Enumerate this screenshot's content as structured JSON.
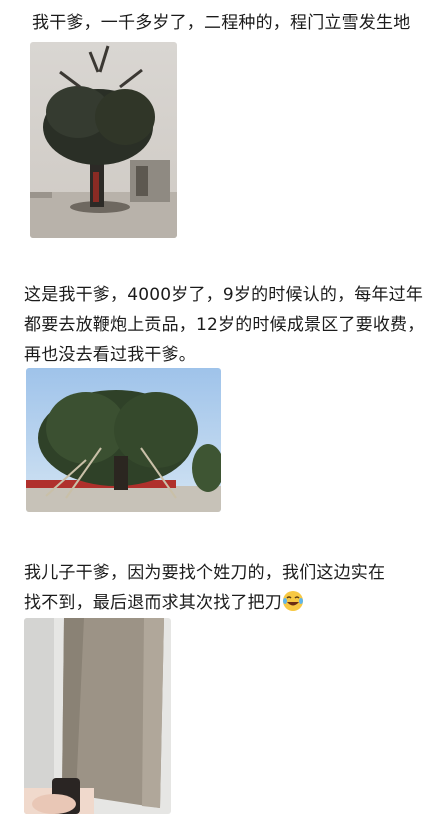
{
  "posts": [
    {
      "text": "我干爹，一千多岁了，二程种的，程门立雪发生地",
      "image": "old-cypress-tree-photo"
    },
    {
      "text": "这是我干爹，4000岁了，9岁的时候认的，每年过年都要去放鞭炮上贡品，12岁的时候成景区了要收费，再也没去看过我干爹。",
      "image": "ancient-tree-scenic-area-photo"
    },
    {
      "text": "我儿子干爹，因为要找个姓刀的，我们这边实在找不到，最后退而求其次找了把刀",
      "emoji": "laughing-tears-emoji",
      "image": "cleaver-knife-photo"
    }
  ]
}
